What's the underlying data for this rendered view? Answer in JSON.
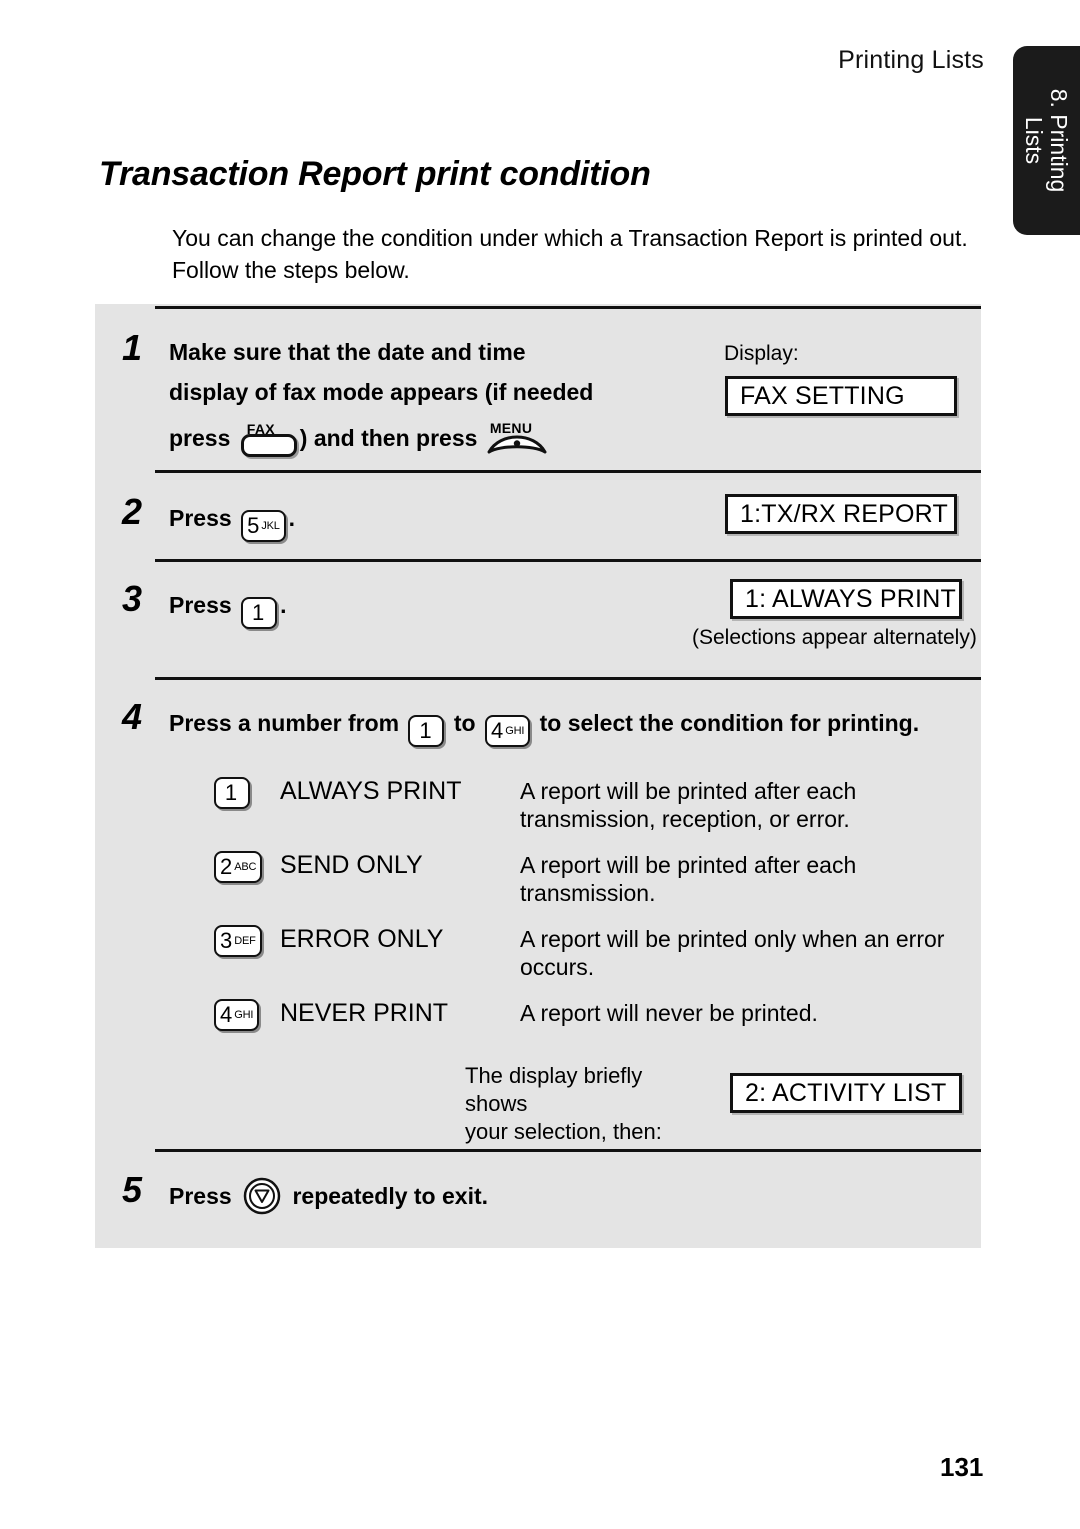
{
  "header": {
    "running_head": "Printing Lists"
  },
  "side_tab": {
    "line1": "8. Printing",
    "line2": "Lists"
  },
  "section": {
    "title": "Transaction Report print condition",
    "intro": "You can change the condition under which a Transaction Report is printed out. Follow the steps below."
  },
  "steps": {
    "one": {
      "number": "1",
      "line1": "Make sure that the date and time",
      "line2": "display of fax mode appears (if needed",
      "line3_pre": "press",
      "line3_mid": ") and then press",
      "fax_key_label": "FAX",
      "menu_key_label": "MENU",
      "display_label": "Display:",
      "display_value": "FAX SETTING"
    },
    "two": {
      "number": "2",
      "press_label": "Press",
      "key_digit": "5",
      "key_letters": "JKL",
      "trailing": ".",
      "display_value": "1:TX/RX REPORT"
    },
    "three": {
      "number": "3",
      "press_label": "Press",
      "key_digit": "1",
      "key_letters": "",
      "trailing": ".",
      "display_value": "1: ALWAYS PRINT",
      "note": "(Selections appear alternately)"
    },
    "four": {
      "number": "4",
      "text_pre": "Press a number from",
      "from_key_digit": "1",
      "from_key_letters": "",
      "text_mid": "to",
      "to_key_digit": "4",
      "to_key_letters": "GHI",
      "text_post": "to select the condition for printing.",
      "options": [
        {
          "key_digit": "1",
          "key_letters": "",
          "name": "ALWAYS PRINT",
          "desc": "A report will be printed after each transmission, reception, or error."
        },
        {
          "key_digit": "2",
          "key_letters": "ABC",
          "name": "SEND ONLY",
          "desc": "A report will be printed after each transmission."
        },
        {
          "key_digit": "3",
          "key_letters": "DEF",
          "name": "ERROR ONLY",
          "desc": "A report will be printed only when an error occurs."
        },
        {
          "key_digit": "4",
          "key_letters": "GHI",
          "name": "NEVER PRINT",
          "desc": "A report will never be printed."
        }
      ],
      "after_note_line1": "The display briefly shows",
      "after_note_line2": "your selection, then:",
      "after_display_value": "2: ACTIVITY LIST"
    },
    "five": {
      "number": "5",
      "press_label": "Press",
      "text_post": "repeatedly to exit."
    }
  },
  "footer": {
    "page_number": "131"
  }
}
